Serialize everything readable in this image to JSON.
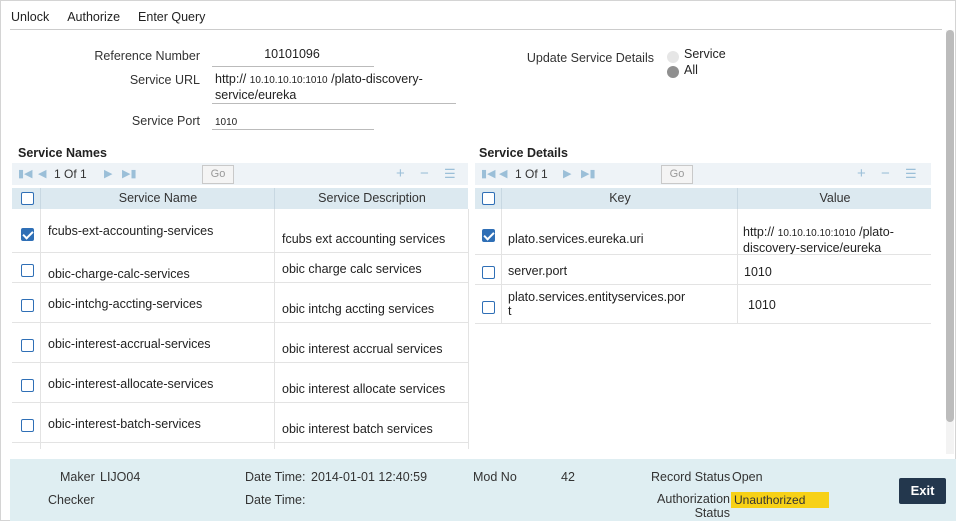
{
  "menu": {
    "unlock": "Unlock",
    "authorize": "Authorize",
    "enter_query": "Enter Query"
  },
  "form": {
    "ref_label": "Reference Number",
    "ref_value": "10101096",
    "url_label": "Service URL",
    "url_prefix": "http://",
    "url_ip": "10.10.10.10:1010",
    "url_rest": "/plato-discovery-",
    "url_line2": "service/eureka",
    "port_label": "Service Port",
    "port_value": "1010",
    "update_label": "Update Service Details",
    "radio_service": "Service",
    "radio_all": "All"
  },
  "service_names": {
    "title": "Service Names",
    "page": "1 Of 1",
    "go": "Go",
    "col_name": "Service Name",
    "col_desc": "Service Description",
    "rows": [
      {
        "name": "fcubs-ext-accounting-services",
        "desc": "fcubs ext accounting services",
        "checked": true
      },
      {
        "name": "obic-charge-calc-services",
        "desc": "obic charge calc services",
        "checked": false
      },
      {
        "name": "obic-intchg-accting-services",
        "desc": "obic intchg accting services",
        "checked": false
      },
      {
        "name": "obic-interest-accrual-services",
        "desc": "obic interest accrual services",
        "checked": false
      },
      {
        "name": "obic-interest-allocate-services",
        "desc": "obic interest allocate services",
        "checked": false
      },
      {
        "name": "obic-interest-batch-services",
        "desc": "obic interest batch services",
        "checked": false
      }
    ]
  },
  "service_details": {
    "title": "Service Details",
    "page": "1 Of 1",
    "go": "Go",
    "col_key": "Key",
    "col_value": "Value",
    "rows": [
      {
        "key": "plato.services.eureka.uri",
        "value_prefix": "http://",
        "value_ip": "10.10.10.10:1010",
        "value_rest": "/plato-",
        "value_line2": "discovery-service/eureka",
        "checked": true
      },
      {
        "key": "server.port",
        "value": "1010",
        "checked": false
      },
      {
        "key": "plato.services.entityservices.por",
        "key_line2": "t",
        "value": "1010",
        "checked": false
      }
    ]
  },
  "footer": {
    "maker_label": "Maker",
    "maker_value": "LIJO04",
    "dt_label": "Date Time:",
    "dt_value": "2014-01-01 12:40:59",
    "mod_label": "Mod No",
    "mod_value": "42",
    "rec_label": "Record Status",
    "rec_value": "Open",
    "checker_label": "Checker",
    "dt2_label": "Date Time:",
    "auth_label1": "Authorization",
    "auth_label2": "Status",
    "auth_value": "Unauthorized",
    "exit": "Exit"
  },
  "colors": {
    "accent": "#2f6fb6",
    "header_bg": "#dce9f0",
    "footer_bg": "#dfeef2",
    "badge": "#f7d117",
    "exit_bg": "#23374d"
  }
}
